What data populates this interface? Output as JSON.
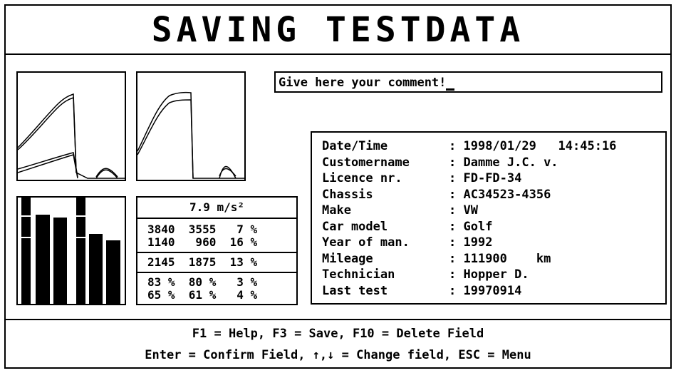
{
  "header": {
    "title": "SAVING TESTDATA"
  },
  "comment": {
    "text": "Give here your comment!"
  },
  "info": [
    {
      "label": "Date/Time",
      "value": "1998/01/29   14:45:16"
    },
    {
      "label": "Customername",
      "value": "Damme J.C. v."
    },
    {
      "label": "Licence nr.",
      "value": "FD-FD-34"
    },
    {
      "label": "Chassis",
      "value": "AC34523-4356"
    },
    {
      "label": "Make",
      "value": "VW"
    },
    {
      "label": "Car model",
      "value": "Golf"
    },
    {
      "label": "Year of man.",
      "value": "1992"
    },
    {
      "label": "Mileage",
      "value": "111900    km"
    },
    {
      "label": "Technician",
      "value": "Hopper D."
    },
    {
      "label": "Last test",
      "value": "19970914"
    }
  ],
  "measurements": {
    "acceleration": "7.9 m/s²",
    "rows": [
      "3840  3555   7 %",
      "1140   960  16 %",
      "2145  1875  13 %",
      "83 %  80 %   3 %",
      "65 %  61 %   4 %"
    ]
  },
  "bar_levels": [
    1.0,
    0.84,
    0.81,
    1.0,
    0.66,
    0.6
  ],
  "footer": {
    "line1": "F1 = Help,  F3 = Save,  F10 = Delete Field",
    "line2": "Enter = Confirm Field,  ↑,↓ = Change field,  ESC = Menu"
  }
}
